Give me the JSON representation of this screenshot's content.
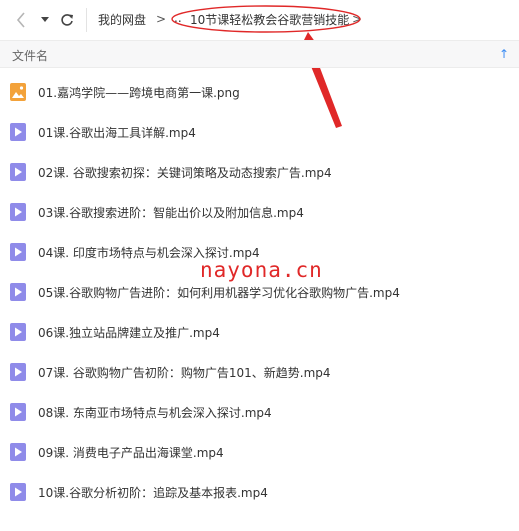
{
  "toolbar": {
    "back_icon": "chevron-left-icon",
    "dropdown_icon": "caret-down-icon",
    "refresh_icon": "refresh-icon"
  },
  "breadcrumb": {
    "root": "我的网盘",
    "ellipsis": "..",
    "current": "10节课轻松教会谷歌营销技能"
  },
  "header": {
    "col_name": "文件名",
    "sort_icon": "↑"
  },
  "files": [
    {
      "name": "01.嘉鸿学院——跨境电商第一课.png",
      "type": "image"
    },
    {
      "name": "01课.谷歌出海工具详解.mp4",
      "type": "video"
    },
    {
      "name": "02课. 谷歌搜索初探：关键词策略及动态搜索广告.mp4",
      "type": "video"
    },
    {
      "name": "03课.谷歌搜索进阶：智能出价以及附加信息.mp4",
      "type": "video"
    },
    {
      "name": "04课. 印度市场特点与机会深入探讨.mp4",
      "type": "video"
    },
    {
      "name": "05课.谷歌购物广告进阶：如何利用机器学习优化谷歌购物广告.mp4",
      "type": "video"
    },
    {
      "name": "06课.独立站品牌建立及推广.mp4",
      "type": "video"
    },
    {
      "name": "07课. 谷歌购物广告初阶：购物广告101、新趋势.mp4",
      "type": "video"
    },
    {
      "name": "08课. 东南亚市场特点与机会深入探讨.mp4",
      "type": "video"
    },
    {
      "name": "09课. 消费电子产品出海课堂.mp4",
      "type": "video"
    },
    {
      "name": "10课.谷歌分析初阶：追踪及基本报表.mp4",
      "type": "video"
    }
  ],
  "watermark": "nayona.cn",
  "colors": {
    "video_icon": "#8f8be9",
    "image_icon": "#f3a23a",
    "annotation": "#e02828",
    "accent": "#3b8cf3"
  }
}
